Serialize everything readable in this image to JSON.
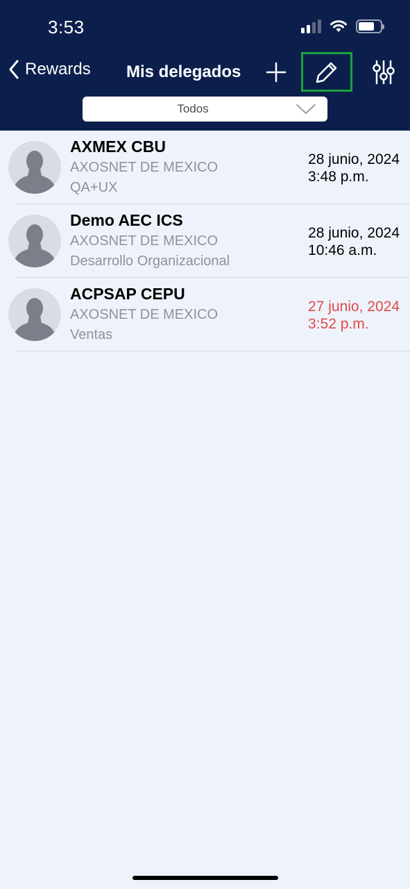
{
  "status_bar": {
    "time": "3:53",
    "icons": [
      "cellular-signal-icon",
      "wifi-icon",
      "battery-icon"
    ]
  },
  "nav": {
    "back_label": "Rewards",
    "title": "Mis delegados",
    "actions": [
      "plus-icon",
      "pencil-icon",
      "sliders-icon"
    ],
    "highlight_color": "#19a33c"
  },
  "filter": {
    "selected": "Todos"
  },
  "delegates": [
    {
      "name": "AXMEX CBU",
      "company": "AXOSNET DE MEXICO",
      "department": "QA+UX",
      "date": "28 junio, 2024",
      "time": "3:48 p.m."
    },
    {
      "name": "Demo AEC ICS",
      "company": "AXOSNET DE MEXICO",
      "department": "Desarrollo Organizacional",
      "date": "28 junio, 2024",
      "time": "10:46 a.m."
    },
    {
      "name": "ACPSAP CEPU",
      "company": "AXOSNET DE MEXICO",
      "department": "Ventas",
      "date": "27 junio, 2024",
      "time": "3:52 p.m."
    }
  ],
  "colors": {
    "header_bg": "#0c1f4c",
    "page_bg": "#eef3fb",
    "overdue_date": "#e04a4a"
  }
}
